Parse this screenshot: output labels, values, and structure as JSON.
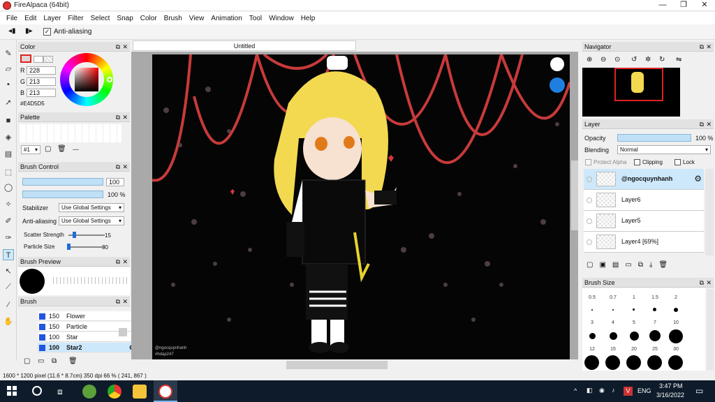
{
  "window": {
    "title": "FireAlpaca (64bit)",
    "minimize": "—",
    "maximize": "❐",
    "close": "✕"
  },
  "menu": [
    "File",
    "Edit",
    "Layer",
    "Filter",
    "Select",
    "Snap",
    "Color",
    "Brush",
    "View",
    "Animation",
    "Tool",
    "Window",
    "Help"
  ],
  "toolbar": {
    "antialias_label": "Anti-aliasing",
    "antialias_checked": true
  },
  "color_panel": {
    "title": "Color",
    "r_label": "R",
    "r": "228",
    "g_label": "G",
    "g": "213",
    "b_label": "B",
    "b": "213",
    "hex": "#E4D5D5",
    "current_color": "#e4d5d5"
  },
  "palette_panel": {
    "title": "Palette",
    "index": "#1",
    "dashes": "---"
  },
  "brush_control": {
    "title": "Brush Control",
    "width": "100",
    "opacity": "100 %",
    "stabilizer_label": "Stabilizer",
    "stabilizer_value": "Use Global Settings",
    "antialias_label": "Anti-aliasing",
    "antialias_value": "Use Global Settings",
    "scatter_label": "Scatter Strength",
    "scatter_value": "15",
    "particle_label": "Particle Size",
    "particle_value": "30"
  },
  "brush_preview": {
    "title": "Brush Preview"
  },
  "brush_panel": {
    "title": "Brush",
    "items": [
      {
        "size": "150",
        "name": "Flower"
      },
      {
        "size": "150",
        "name": "Particle"
      },
      {
        "size": "100",
        "name": "Star"
      },
      {
        "size": "100",
        "name": "Star2"
      }
    ]
  },
  "document": {
    "tab": "Untitled",
    "credit1": "@ngocquynhanh",
    "credit2": "#hdap247"
  },
  "navigator": {
    "title": "Navigator"
  },
  "layer_panel": {
    "title": "Layer",
    "opacity_label": "Opacity",
    "opacity_value": "100 %",
    "blending_label": "Blending",
    "blending_value": "Normal",
    "protect_alpha": "Protect Alpha",
    "clipping": "Clipping",
    "lock": "Lock",
    "layers": [
      "@ngocquynhanh",
      "Layer6",
      "Layer5",
      "Layer4 [69%]"
    ]
  },
  "brush_size_panel": {
    "title": "Brush Size",
    "sizes": [
      "0.5",
      "0.7",
      "1",
      "1.5",
      "2",
      "3",
      "4",
      "5",
      "7",
      "10",
      "12",
      "15",
      "20",
      "25",
      "30"
    ]
  },
  "status": {
    "text": "1600 * 1200 pixel  (11.6 * 8.7cm)  350 dpi  66 %  ( 241, 867 )"
  },
  "taskbar": {
    "time": "3:47 PM",
    "date": "3/16/2022",
    "lang": "ENG"
  }
}
